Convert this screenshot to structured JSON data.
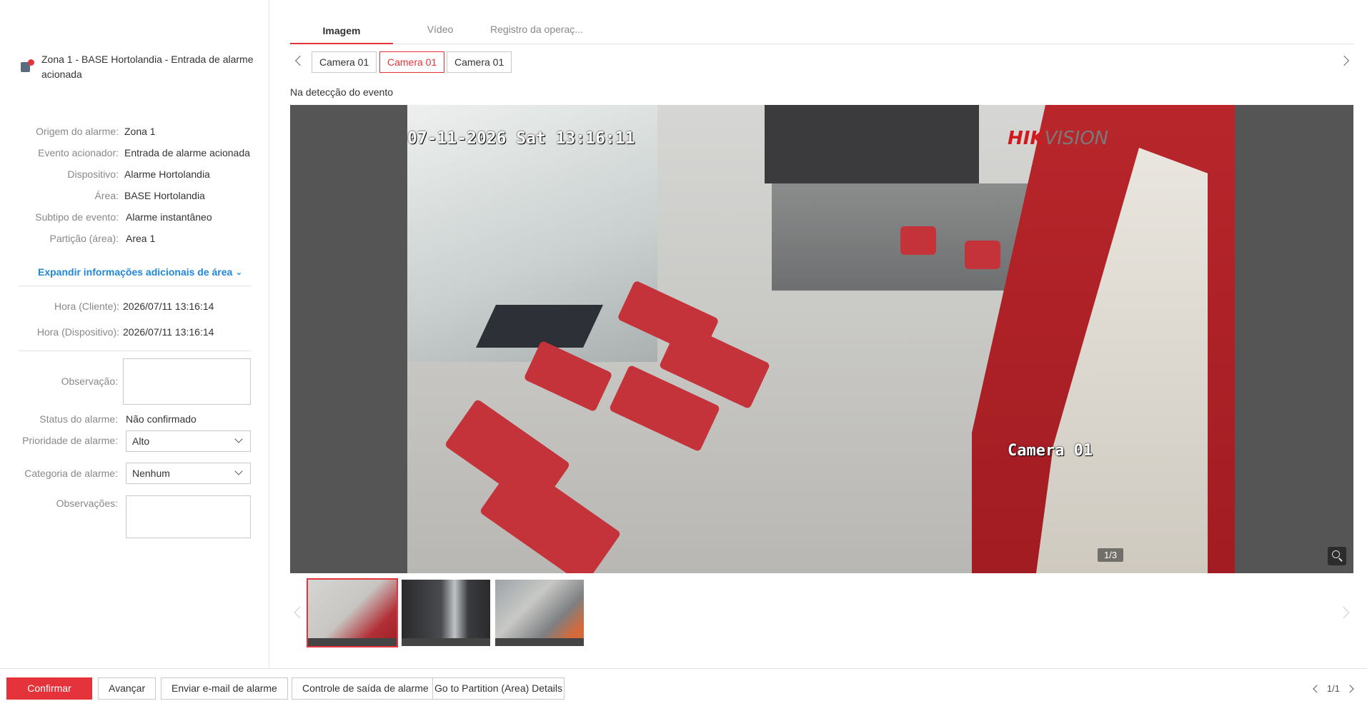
{
  "alarm": {
    "title": "Zona 1 - BASE Hortolandia - Entrada de alarme acionada",
    "icon": "alarm-input-icon"
  },
  "details": [
    {
      "label": "Origem do alarme:",
      "value": "Zona 1"
    },
    {
      "label": "Evento acionador:",
      "value": "Entrada de alarme acionada"
    },
    {
      "label": "Dispositivo:",
      "value": "Alarme Hortolandia"
    },
    {
      "label": "Área:",
      "value": "BASE Hortolandia"
    },
    {
      "label": "Subtipo de evento:",
      "value": "Alarme instantâneo"
    },
    {
      "label": "Partição (área):",
      "value": "Area 1"
    }
  ],
  "expand_label": "Expandir informações adicionais de área",
  "times": [
    {
      "label": "Hora (Cliente):",
      "value": "2026/07/11 13:16:14"
    },
    {
      "label": "Hora (Dispositivo):",
      "value": "2026/07/11 13:16:14"
    }
  ],
  "form": {
    "observacao_label": "Observação:",
    "observacao_value": "",
    "status_label": "Status do alarme:",
    "status_value": "Não confirmado",
    "priority_label": "Prioridade de alarme:",
    "priority_value": "Alto",
    "category_label": "Categoria de alarme:",
    "category_value": "Nenhum",
    "observacoes_label": "Observações:",
    "observacoes_value": ""
  },
  "tabs": [
    {
      "label": "Imagem",
      "active": true
    },
    {
      "label": "Vídeo",
      "active": false
    },
    {
      "label": "Registro da operaç...",
      "active": false
    }
  ],
  "cameras": [
    {
      "label": "Camera 01",
      "active": false
    },
    {
      "label": "Camera 01",
      "active": true
    },
    {
      "label": "Camera 01",
      "active": false
    }
  ],
  "caption": "Na detecção do evento",
  "viewer": {
    "osd_datetime": "07-11-2026 Sat 13:16:11",
    "osd_camera": "Camera 01",
    "brand_main": "HIK",
    "brand_sub": "VISION",
    "counter": "1/3"
  },
  "buttons": {
    "confirm": "Confirmar",
    "advance": "Avançar",
    "email": "Enviar e-mail de alarme",
    "output": "Controle de saída de alarme",
    "partition": "Go to Partition (Area) Details"
  },
  "pager": "1/1",
  "colors": {
    "accent": "#e5333b",
    "link": "#1f86d9"
  }
}
